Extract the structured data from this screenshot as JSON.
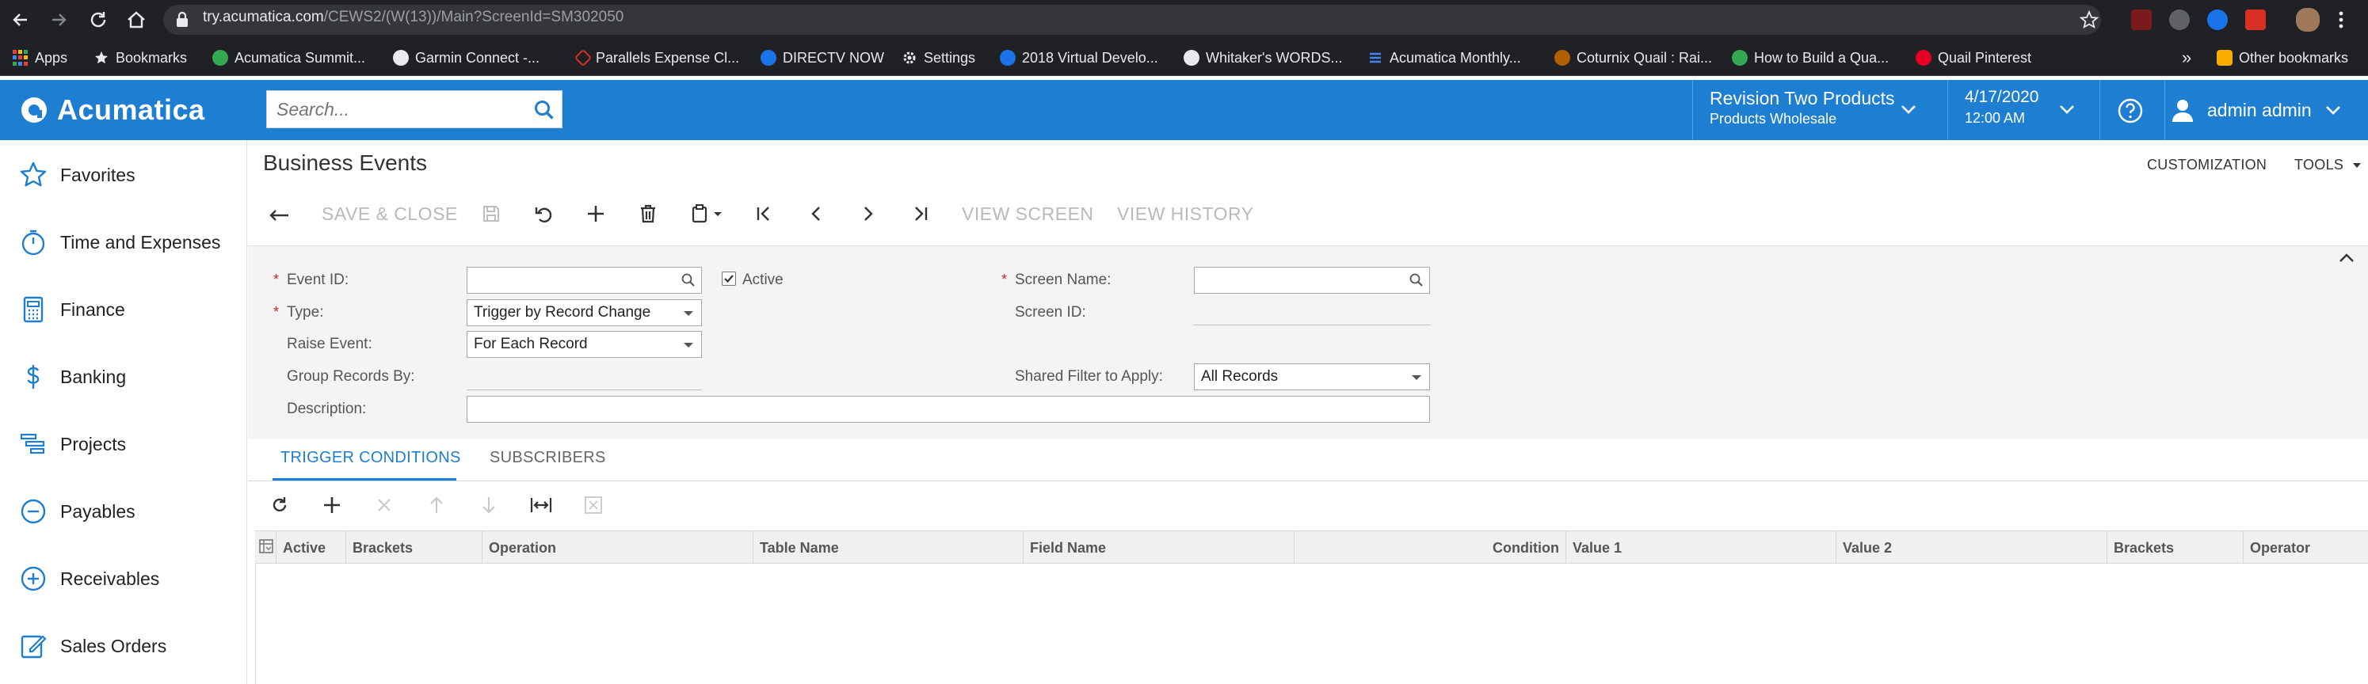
{
  "browser": {
    "url_host": "try.acumatica.com",
    "url_path": "/CEWS2/(W(13))/Main?ScreenId=SM302050",
    "bookmarks": [
      {
        "label": "Apps",
        "icon": "apps-grid-icon",
        "color": "#ea4335"
      },
      {
        "label": "Bookmarks",
        "icon": "star-icon",
        "color": "#e8eaed"
      },
      {
        "label": "Acumatica Summit...",
        "icon": "acumatica-summit-icon",
        "color": "#34a853"
      },
      {
        "label": "Garmin Connect -...",
        "icon": "garmin-icon",
        "color": "#e8eaed"
      },
      {
        "label": "Parallels Expense Cl...",
        "icon": "parallels-icon",
        "color": "#d93025"
      },
      {
        "label": "DIRECTV NOW",
        "icon": "directv-icon",
        "color": "#1a73e8"
      },
      {
        "label": "Settings",
        "icon": "gear-icon",
        "color": "#e8eaed"
      },
      {
        "label": "2018 Virtual Develo...",
        "icon": "acumatica-icon",
        "color": "#1a73e8"
      },
      {
        "label": "Whitaker's WORDS...",
        "icon": "globe-icon",
        "color": "#e8eaed"
      },
      {
        "label": "Acumatica Monthly...",
        "icon": "list-icon",
        "color": "#4285f4"
      },
      {
        "label": "Coturnix Quail : Rai...",
        "icon": "quail-icon",
        "color": "#b06000"
      },
      {
        "label": "How to Build a Qua...",
        "icon": "leaf-icon",
        "color": "#34a853"
      },
      {
        "label": "Quail Pinterest",
        "icon": "pinterest-icon",
        "color": "#e60023"
      }
    ],
    "overflow": "»",
    "other_bookmarks": "Other bookmarks"
  },
  "header": {
    "logo": "Acumatica",
    "search_placeholder": "Search...",
    "company": "Revision Two Products",
    "branch": "Products Wholesale",
    "date": "4/17/2020",
    "time": "12:00 AM",
    "user": "admin admin"
  },
  "sidebar": {
    "items": [
      {
        "label": "Favorites",
        "icon": "star-outline-icon"
      },
      {
        "label": "Time and Expenses",
        "icon": "stopwatch-icon"
      },
      {
        "label": "Finance",
        "icon": "calculator-icon"
      },
      {
        "label": "Banking",
        "icon": "dollar-icon"
      },
      {
        "label": "Projects",
        "icon": "gantt-icon"
      },
      {
        "label": "Payables",
        "icon": "minus-circle-icon"
      },
      {
        "label": "Receivables",
        "icon": "plus-circle-icon"
      },
      {
        "label": "Sales Orders",
        "icon": "edit-square-icon"
      }
    ]
  },
  "page": {
    "title": "Business Events",
    "customization": "CUSTOMIZATION",
    "tools": "TOOLS",
    "toolbar": {
      "save_close": "SAVE & CLOSE",
      "view_screen": "VIEW SCREEN",
      "view_history": "VIEW HISTORY"
    }
  },
  "form": {
    "event_id_label": "Event ID:",
    "event_id_value": "",
    "active_label": "Active",
    "active_checked": true,
    "type_label": "Type:",
    "type_value": "Trigger by Record Change",
    "raise_event_label": "Raise Event:",
    "raise_event_value": "For Each Record",
    "group_records_label": "Group Records By:",
    "description_label": "Description:",
    "description_value": "",
    "screen_name_label": "Screen Name:",
    "screen_name_value": "",
    "screen_id_label": "Screen ID:",
    "shared_filter_label": "Shared Filter to Apply:",
    "shared_filter_value": "All Records",
    "required_mark": "*"
  },
  "tabs": [
    {
      "label": "TRIGGER CONDITIONS",
      "active": true
    },
    {
      "label": "SUBSCRIBERS",
      "active": false
    }
  ],
  "grid": {
    "columns": [
      "Active",
      "Brackets",
      "Operation",
      "Table Name",
      "Field Name",
      "Condition",
      "Value 1",
      "Value 2",
      "Brackets",
      "Operator"
    ]
  },
  "colors": {
    "brand": "#1e7ed1",
    "browser_dark": "#202124",
    "required": "#c62828"
  }
}
